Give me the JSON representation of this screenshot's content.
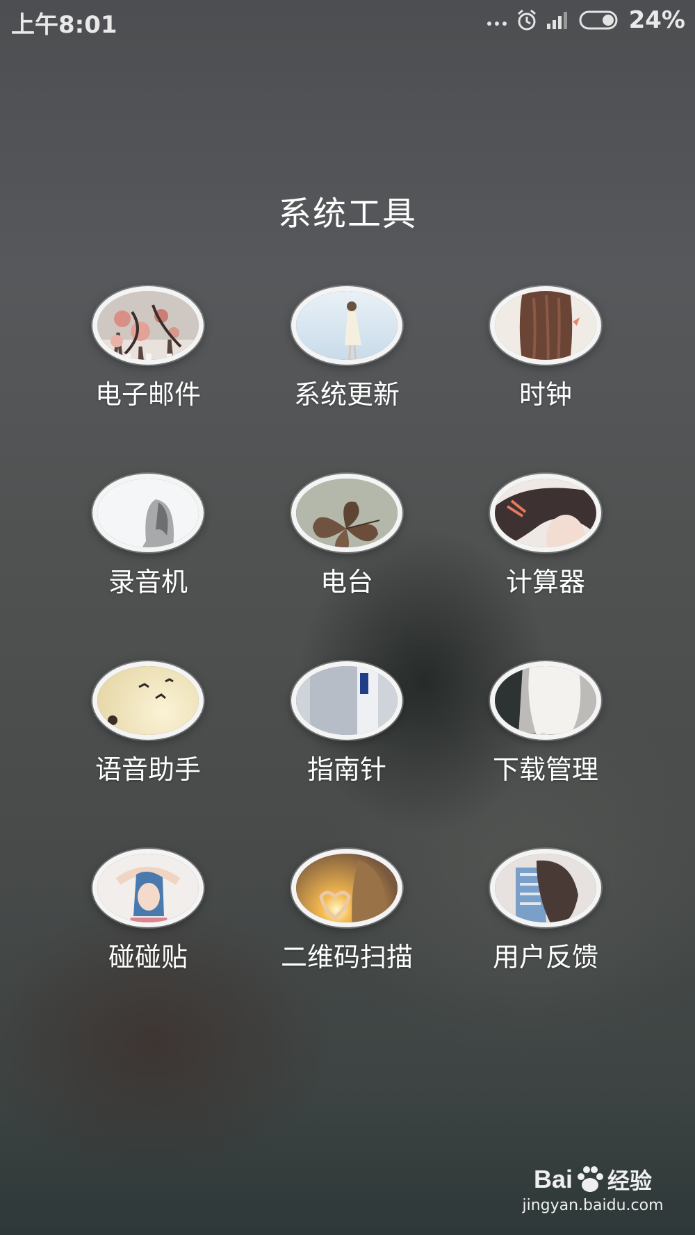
{
  "status_bar": {
    "time": "上午8:01",
    "battery_percent": "24%",
    "battery_level": 0.24,
    "icons": [
      "more-dots-icon",
      "alarm-icon",
      "signal-icon",
      "battery-icon"
    ]
  },
  "page": {
    "title": "系统工具"
  },
  "apps": [
    {
      "label": "电子邮件",
      "icon": "roses-photo-icon"
    },
    {
      "label": "系统更新",
      "icon": "girl-on-beach-icon"
    },
    {
      "label": "时钟",
      "icon": "long-hair-icon"
    },
    {
      "label": "录音机",
      "icon": "girl-silhouette-icon"
    },
    {
      "label": "电台",
      "icon": "dried-leaves-icon"
    },
    {
      "label": "计算器",
      "icon": "girl-face-icon"
    },
    {
      "label": "语音助手",
      "icon": "birds-girl-icon"
    },
    {
      "label": "指南针",
      "icon": "sprout-icon"
    },
    {
      "label": "下载管理",
      "icon": "legs-skirt-icon"
    },
    {
      "label": "碰碰贴",
      "icon": "arms-up-girl-icon"
    },
    {
      "label": "二维码扫描",
      "icon": "heart-sunset-icon"
    },
    {
      "label": "用户反馈",
      "icon": "sitting-girl-icon"
    }
  ],
  "watermark": {
    "logo_text": "Bai",
    "logo_text_2": "经验",
    "url": "jingyan.baidu.com"
  }
}
